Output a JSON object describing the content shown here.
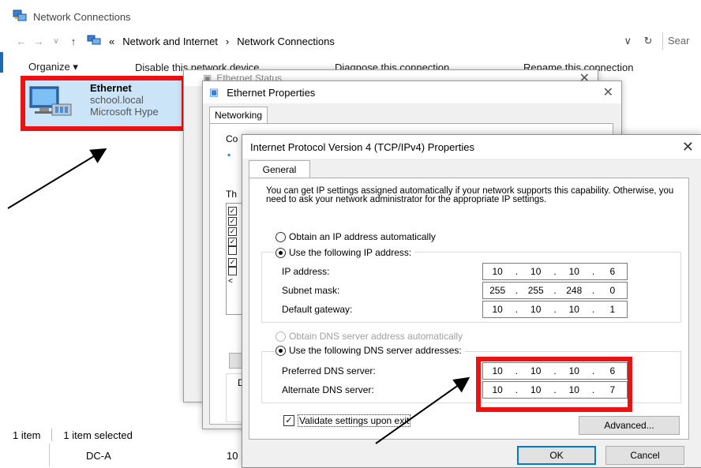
{
  "window": {
    "title": "Network Connections"
  },
  "nav": {
    "breadcrumb": [
      "Network and Internet",
      "Network Connections"
    ],
    "search_placeholder": "Sear"
  },
  "toolbar": {
    "organize": "Organize",
    "disable": "Disable this network device",
    "diagnose": "Diagnose this connection",
    "rename": "Rename this connection"
  },
  "connection": {
    "name": "Ethernet",
    "domain": "school.local",
    "adapter": "Microsoft Hype"
  },
  "status_bar": {
    "count": "1 item",
    "selected": "1 item selected"
  },
  "lower_row": {
    "name": "DC-A",
    "value": "10"
  },
  "ethernet_status": {
    "title": "Ethernet Status"
  },
  "ethernet_properties": {
    "title": "Ethernet Properties",
    "tab": "Networking",
    "connect_label": "Co",
    "items_label": "Th",
    "desc_label": "D"
  },
  "ipv4": {
    "title": "Internet Protocol Version 4 (TCP/IPv4) Properties",
    "tab": "General",
    "description": "You can get IP settings assigned automatically if your network supports this capability. Otherwise, you need to ask your network administrator for the appropriate IP settings.",
    "obtain_ip_auto": "Obtain an IP address automatically",
    "use_following_ip": "Use the following IP address:",
    "ip_address_label": "IP address:",
    "ip_address": [
      "10",
      "10",
      "10",
      "6"
    ],
    "subnet_label": "Subnet mask:",
    "subnet": [
      "255",
      "255",
      "248",
      "0"
    ],
    "gateway_label": "Default gateway:",
    "gateway": [
      "10",
      "10",
      "10",
      "1"
    ],
    "obtain_dns_auto": "Obtain DNS server address automatically",
    "use_following_dns": "Use the following DNS server addresses:",
    "preferred_dns_label": "Preferred DNS server:",
    "preferred_dns": [
      "10",
      "10",
      "10",
      "6"
    ],
    "alternate_dns_label": "Alternate DNS server:",
    "alternate_dns": [
      "10",
      "10",
      "10",
      "7"
    ],
    "validate_label": "Validate settings upon exit",
    "advanced_button": "Advanced...",
    "ok_button": "OK",
    "cancel_button": "Cancel"
  },
  "colors": {
    "highlight": "#e11111",
    "accent": "#1e69b6",
    "tile": "#cce4f7"
  }
}
